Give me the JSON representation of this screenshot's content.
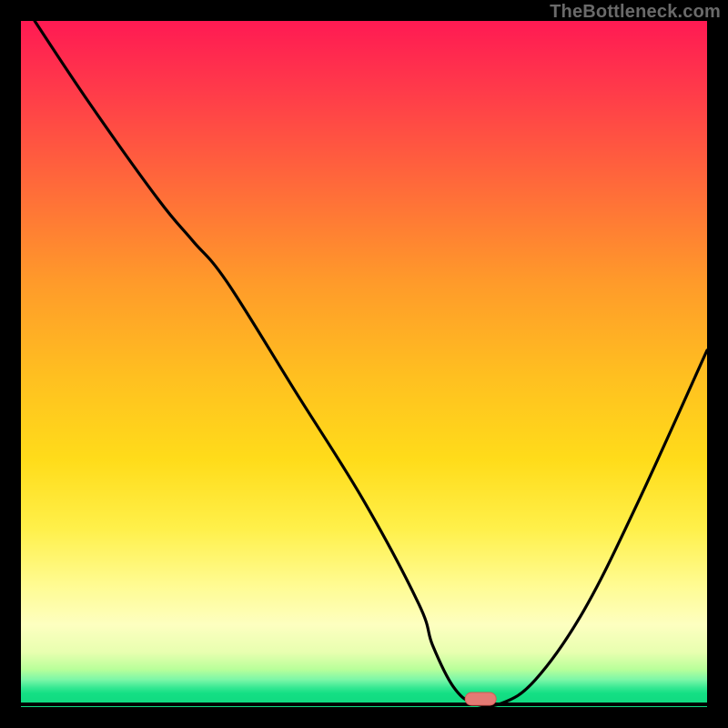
{
  "watermark": "TheBottleneck.com",
  "colors": {
    "frame": "#000000",
    "curve_stroke": "#000000",
    "marker_fill": "#e47a74",
    "marker_stroke": "#d55a55",
    "gradient_top": "#ff1a53",
    "gradient_mid": "#ffdc1a",
    "gradient_bottom": "#0fd87f"
  },
  "chart_data": {
    "type": "line",
    "title": "",
    "xlabel": "",
    "ylabel": "",
    "xlim": [
      0,
      100
    ],
    "ylim": [
      0,
      100
    ],
    "x": [
      2,
      10,
      20,
      25,
      30,
      40,
      50,
      58,
      60,
      63,
      66,
      70,
      75,
      82,
      90,
      100
    ],
    "y": [
      100,
      88,
      74,
      68,
      62,
      46,
      30,
      15,
      9,
      3,
      0.5,
      0.5,
      4,
      14,
      30,
      52
    ],
    "optimum_marker": {
      "x": 67,
      "y": 0.5
    },
    "note": "x in percent of horizontal extent, y in percent of vertical extent (0 = bottom green baseline, 100 = top). Values estimated from pixel positions; no axis ticks or numeric labels are present in the source image."
  }
}
